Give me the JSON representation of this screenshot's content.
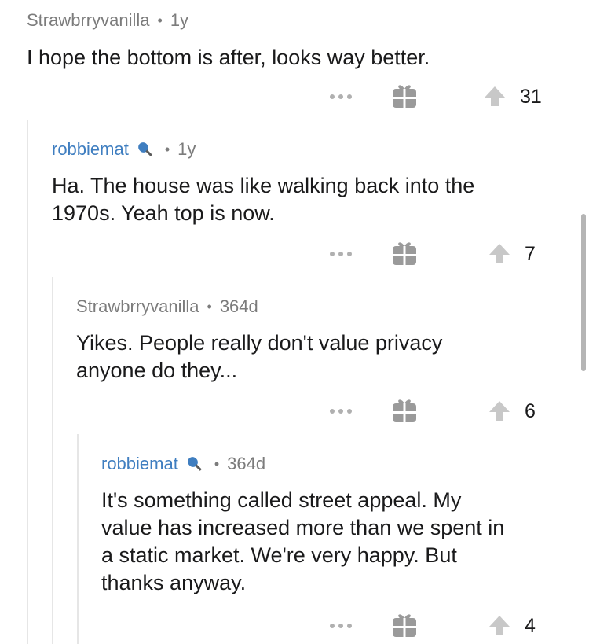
{
  "comments": [
    {
      "author": "Strawbrryvanilla",
      "age": "1y",
      "body_lines": [
        "I hope the bottom is after, looks way better."
      ],
      "votes": "31",
      "is_op": true
    },
    {
      "author": "robbiemat",
      "age": "1y",
      "body_lines": [
        "Ha. The house was like walking back into the",
        "1970s. Yeah top is now."
      ],
      "votes": "7",
      "is_op": false
    },
    {
      "author": "Strawbrryvanilla",
      "age": "364d",
      "body_lines": [
        "Yikes. People really don't value privacy",
        "anyone do they..."
      ],
      "votes": "6",
      "is_op": true
    },
    {
      "author": "robbiemat",
      "age": "364d",
      "body_lines": [
        "It's something called street appeal. My",
        "value has increased more than we spent in",
        "a static market. We're very happy. But",
        "thanks anyway."
      ],
      "votes": "4",
      "is_op": false
    }
  ],
  "separator": "•",
  "icons": {
    "more": "more-options-icon",
    "award": "gift-award-icon",
    "upvote": "upvote-arrow-icon",
    "flair": "microphone-flair-icon"
  },
  "colors": {
    "text": "#1a1a1b",
    "meta": "#7c7c7c",
    "username_link": "#3f7ec0",
    "icon_gray": "#c8c8c8",
    "thread_line": "#e6e6e6"
  }
}
